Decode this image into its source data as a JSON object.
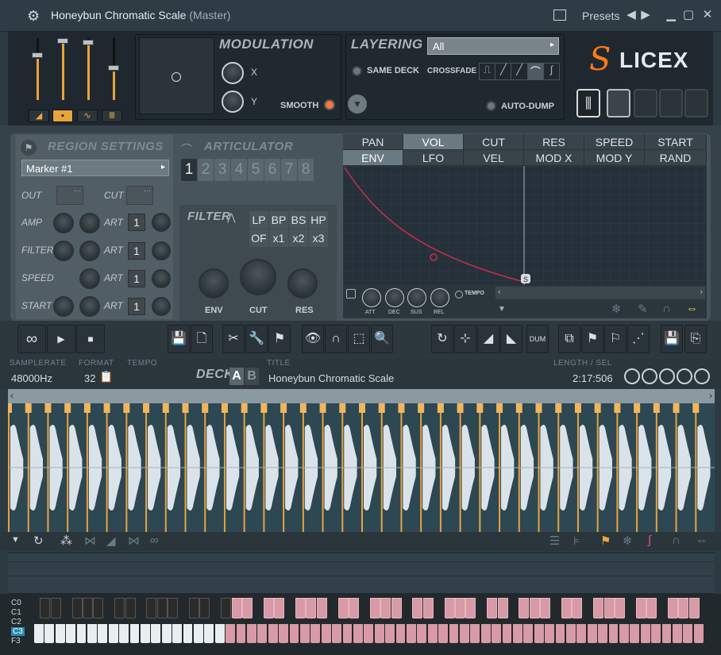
{
  "titlebar": {
    "title": "Honeybun Chromatic Scale",
    "subtitle": "(Master)",
    "presets_label": "Presets"
  },
  "modulation": {
    "header": "MODULATION",
    "x_label": "X",
    "y_label": "Y",
    "smooth_label": "SMOOTH"
  },
  "layering": {
    "header": "LAYERING",
    "select_value": "All",
    "same_deck_label": "SAME DECK",
    "crossfade_label": "CROSSFADE",
    "auto_dump_label": "AUTO-DUMP"
  },
  "logo": {
    "text": "LICEX",
    "s_letter": "S",
    "accent": "#ff7a1a"
  },
  "region": {
    "header": "REGION SETTINGS",
    "marker_value": "Marker #1",
    "out_label": "OUT",
    "cut_label": "CUT",
    "rows": [
      {
        "label": "AMP",
        "art": "ART",
        "num": "1"
      },
      {
        "label": "FILTER",
        "art": "ART",
        "num": "1"
      },
      {
        "label": "SPEED",
        "art": "ART",
        "num": "1"
      },
      {
        "label": "START",
        "art": "ART",
        "num": "1"
      }
    ]
  },
  "articulator": {
    "header": "ARTICULATOR",
    "numbers": [
      "1",
      "2",
      "3",
      "4",
      "5",
      "6",
      "7",
      "8"
    ]
  },
  "filter": {
    "header": "FILTER",
    "types": [
      "LP",
      "BP",
      "BS",
      "HP"
    ],
    "mult": [
      "OF",
      "x1",
      "x2",
      "x3"
    ],
    "knobs": [
      "ENV",
      "CUT",
      "RES"
    ]
  },
  "env_tabs": {
    "row1": [
      "PAN",
      "VOL",
      "CUT",
      "RES",
      "SPEED",
      "START"
    ],
    "row2": [
      "ENV",
      "LFO",
      "VEL",
      "MOD X",
      "MOD Y",
      "RAND"
    ],
    "selected": "VOL"
  },
  "env_knobs": [
    "ATT",
    "DEC",
    "SUS",
    "REL"
  ],
  "tempo_label": "TEMPO",
  "info": {
    "samplerate_label": "SAMPLERATE",
    "samplerate": "48000Hz",
    "format_label": "FORMAT",
    "format": "32",
    "tempo_label": "TEMPO",
    "deck_label": "DECK",
    "deck_a": "A",
    "deck_b": "B",
    "title_label": "TITLE",
    "title": "Honeybun Chromatic Scale",
    "length_label": "LENGTH / SEL",
    "length": "2:17:506"
  },
  "keyboard": {
    "octaves": [
      "C0",
      "C1",
      "C2",
      "C3",
      "F3"
    ]
  }
}
